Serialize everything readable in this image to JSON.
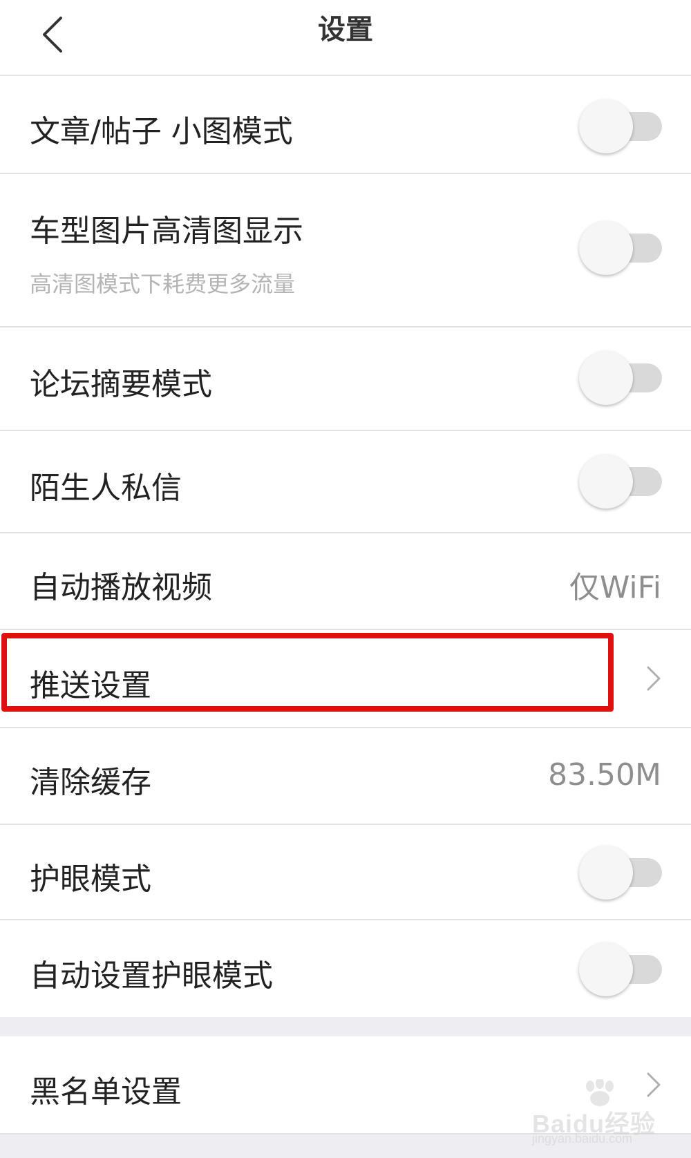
{
  "header": {
    "title": "设置",
    "back_icon": "chevron-left-icon"
  },
  "settings": [
    {
      "label": "文章/帖子 小图模式",
      "control": "toggle",
      "on": false
    },
    {
      "label": "车型图片高清图显示",
      "sublabel": "高清图模式下耗费更多流量",
      "control": "toggle",
      "on": false
    },
    {
      "label": "论坛摘要模式",
      "control": "toggle",
      "on": false
    },
    {
      "label": "陌生人私信",
      "control": "toggle",
      "on": false
    },
    {
      "label": "自动播放视频",
      "control": "value",
      "value": "仅WiFi"
    },
    {
      "label": "推送设置",
      "control": "chevron",
      "highlighted": true
    },
    {
      "label": "清除缓存",
      "control": "value",
      "value": "83.50M"
    },
    {
      "label": "护眼模式",
      "control": "toggle",
      "on": false
    },
    {
      "label": "自动设置护眼模式",
      "control": "toggle",
      "on": false
    }
  ],
  "section2": [
    {
      "label": "黑名单设置",
      "control": "chevron"
    }
  ],
  "watermark": {
    "brand": "Baidu经验",
    "url": "jingyan.baidu.com"
  },
  "colors": {
    "highlight": "#e01010",
    "toggle_off_track": "#d9d9d9",
    "value_text": "#8e8e8e",
    "section_gap": "#eeeef2"
  }
}
